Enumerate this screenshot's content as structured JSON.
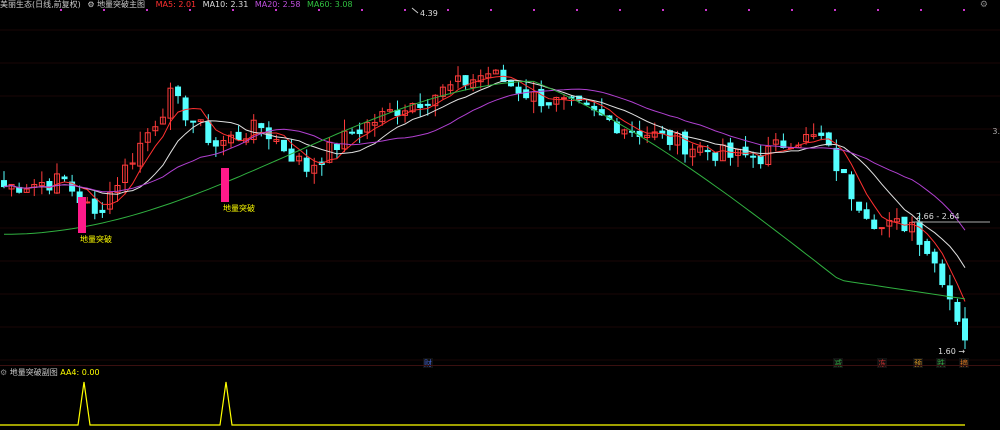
{
  "main_header": {
    "indicator_name": "美丽生态(日线,前复权)",
    "formula_name": "地量突破主图",
    "ma5_label": "MA5: 2.01",
    "ma10_label": "MA10: 2.31",
    "ma20_label": "MA20: 2.58",
    "ma60_label": "MA60: 3.08"
  },
  "sub_header": {
    "formula_name": "地量突破副图",
    "aa4_label": "AA4: 0.00"
  },
  "annotations": {
    "high_price": "4.39",
    "low_price": "1.60",
    "range_label": "2.66 - 2.64",
    "signal_text": "地量突破",
    "axis_tag": "3."
  },
  "event_markers": [
    "财",
    "减",
    "冻",
    "预",
    "跌",
    "摘"
  ],
  "colors": {
    "up": "#ff3b3b",
    "down": "#54ffff",
    "ma5": "#ff3030",
    "ma10": "#e0e0e0",
    "ma20": "#b040d0",
    "ma60": "#30b040",
    "signal": "#ff1a8a",
    "signal_text": "#ffff00",
    "sub_line": "#ffff00",
    "dot": "#cc33cc"
  },
  "chart_data": {
    "type": "candlestick",
    "price_range": [
      1.6,
      4.39
    ],
    "sub_indicator_values": [
      0,
      0,
      0,
      0,
      0,
      0,
      0,
      0,
      0,
      0,
      0,
      0,
      1,
      0,
      0,
      0,
      0,
      0,
      0,
      0,
      0,
      0,
      0,
      0,
      0,
      0,
      0,
      0,
      0,
      0,
      0,
      0,
      0,
      0,
      1,
      0,
      0
    ]
  }
}
